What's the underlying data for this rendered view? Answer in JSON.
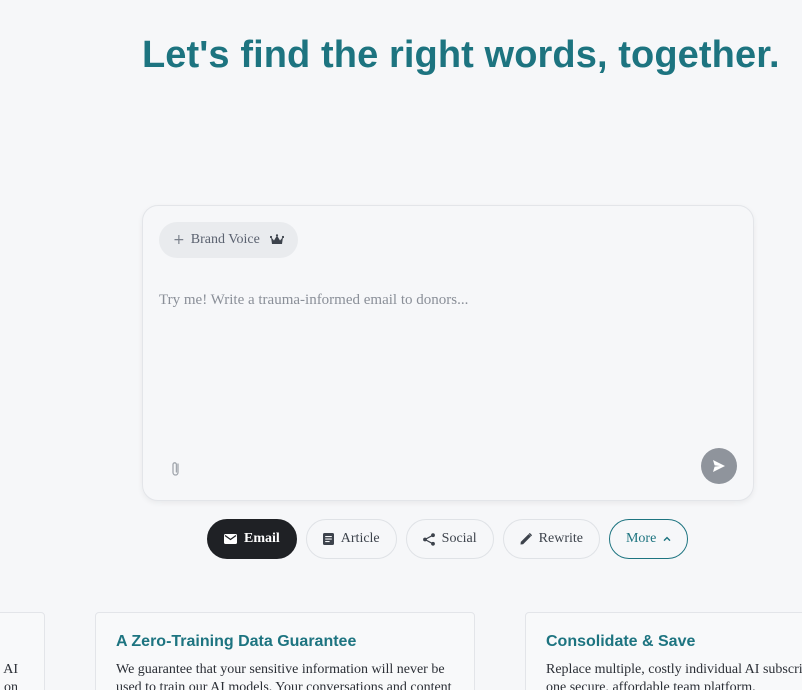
{
  "hero": {
    "title": "Let's find the right words, together."
  },
  "composer": {
    "brand_voice_label": "Brand Voice",
    "placeholder": "Try me! Write a trauma-informed email to donors..."
  },
  "content_types": [
    {
      "label": "Email",
      "icon": "mail-icon",
      "active": true
    },
    {
      "label": "Article",
      "icon": "article-icon",
      "active": false
    },
    {
      "label": "Social",
      "icon": "share-icon",
      "active": false
    },
    {
      "label": "Rewrite",
      "icon": "pencil-icon",
      "active": false
    },
    {
      "label": "More",
      "icon": "chevron-up-icon",
      "active": false
    }
  ],
  "cards": {
    "left_partial_line1": "AI",
    "left_partial_line2": "on",
    "guarantee": {
      "title": "A Zero-Training Data Guarantee",
      "text": "We guarantee that your sensitive information will never be used to train our AI models. Your conversations and content"
    },
    "consolidate": {
      "title": "Consolidate & Save",
      "text": "Replace multiple, costly individual AI subscriptions with one secure, affordable team platform."
    }
  },
  "colors": {
    "accent": "#1d7480",
    "active_button": "#1f2125",
    "send_button": "#8f949c",
    "background": "#f6f7f9"
  }
}
